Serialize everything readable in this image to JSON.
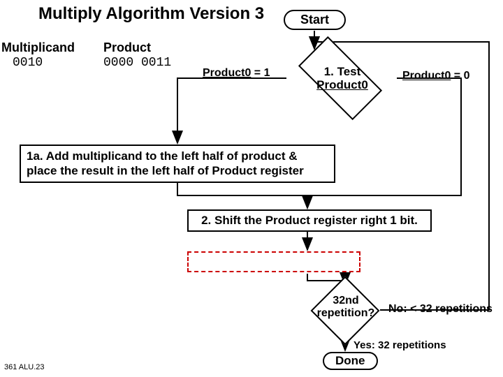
{
  "title": "Multiply Algorithm Version 3",
  "registers": {
    "multiplicand_label": "Multiplicand",
    "multiplicand_value": "0010",
    "product_label": "Product",
    "product_value": "0000 0011"
  },
  "start": "Start",
  "decision1": {
    "line1": "1.",
    "line1b": "Test",
    "line2": "Product0",
    "left_label_a": "Product0",
    "left_label_b": " = 1",
    "right_label_a": "Product0",
    "right_label_b": " = 0"
  },
  "step1a": "1a. Add multiplicand to the left half of product & place the result in the left half of Product register",
  "step2": "2. Shift the Product register right 1 bit.",
  "decision2": {
    "line1": "32nd",
    "line2": "repetition?",
    "no": "No: < 32 repetitions",
    "yes": "Yes: 32 repetitions"
  },
  "done": "Done",
  "footer": "361 ALU.23",
  "chart_data": {
    "type": "flowchart",
    "title": "Multiply Algorithm Version 3",
    "registers": {
      "Multiplicand": "0010",
      "Product": "0000 0011"
    },
    "nodes": [
      {
        "id": "start",
        "kind": "terminator",
        "label": "Start"
      },
      {
        "id": "test",
        "kind": "decision",
        "label": "1. Test Product0"
      },
      {
        "id": "add",
        "kind": "process",
        "label": "1a. Add multiplicand to the left half of product & place the result in the left half of Product register"
      },
      {
        "id": "shift",
        "kind": "process",
        "label": "2. Shift the Product register right 1 bit."
      },
      {
        "id": "placeholder",
        "kind": "process_dashed",
        "label": ""
      },
      {
        "id": "rep",
        "kind": "decision",
        "label": "32nd repetition?"
      },
      {
        "id": "done",
        "kind": "terminator",
        "label": "Done"
      }
    ],
    "edges": [
      {
        "from": "start",
        "to": "test"
      },
      {
        "from": "test",
        "to": "add",
        "label": "Product0 = 1"
      },
      {
        "from": "test",
        "to": "shift",
        "label": "Product0 = 0"
      },
      {
        "from": "add",
        "to": "shift"
      },
      {
        "from": "shift",
        "to": "placeholder"
      },
      {
        "from": "placeholder",
        "to": "rep"
      },
      {
        "from": "rep",
        "to": "done",
        "label": "Yes: 32 repetitions"
      },
      {
        "from": "rep",
        "to": "test",
        "label": "No: < 32 repetitions"
      }
    ]
  }
}
